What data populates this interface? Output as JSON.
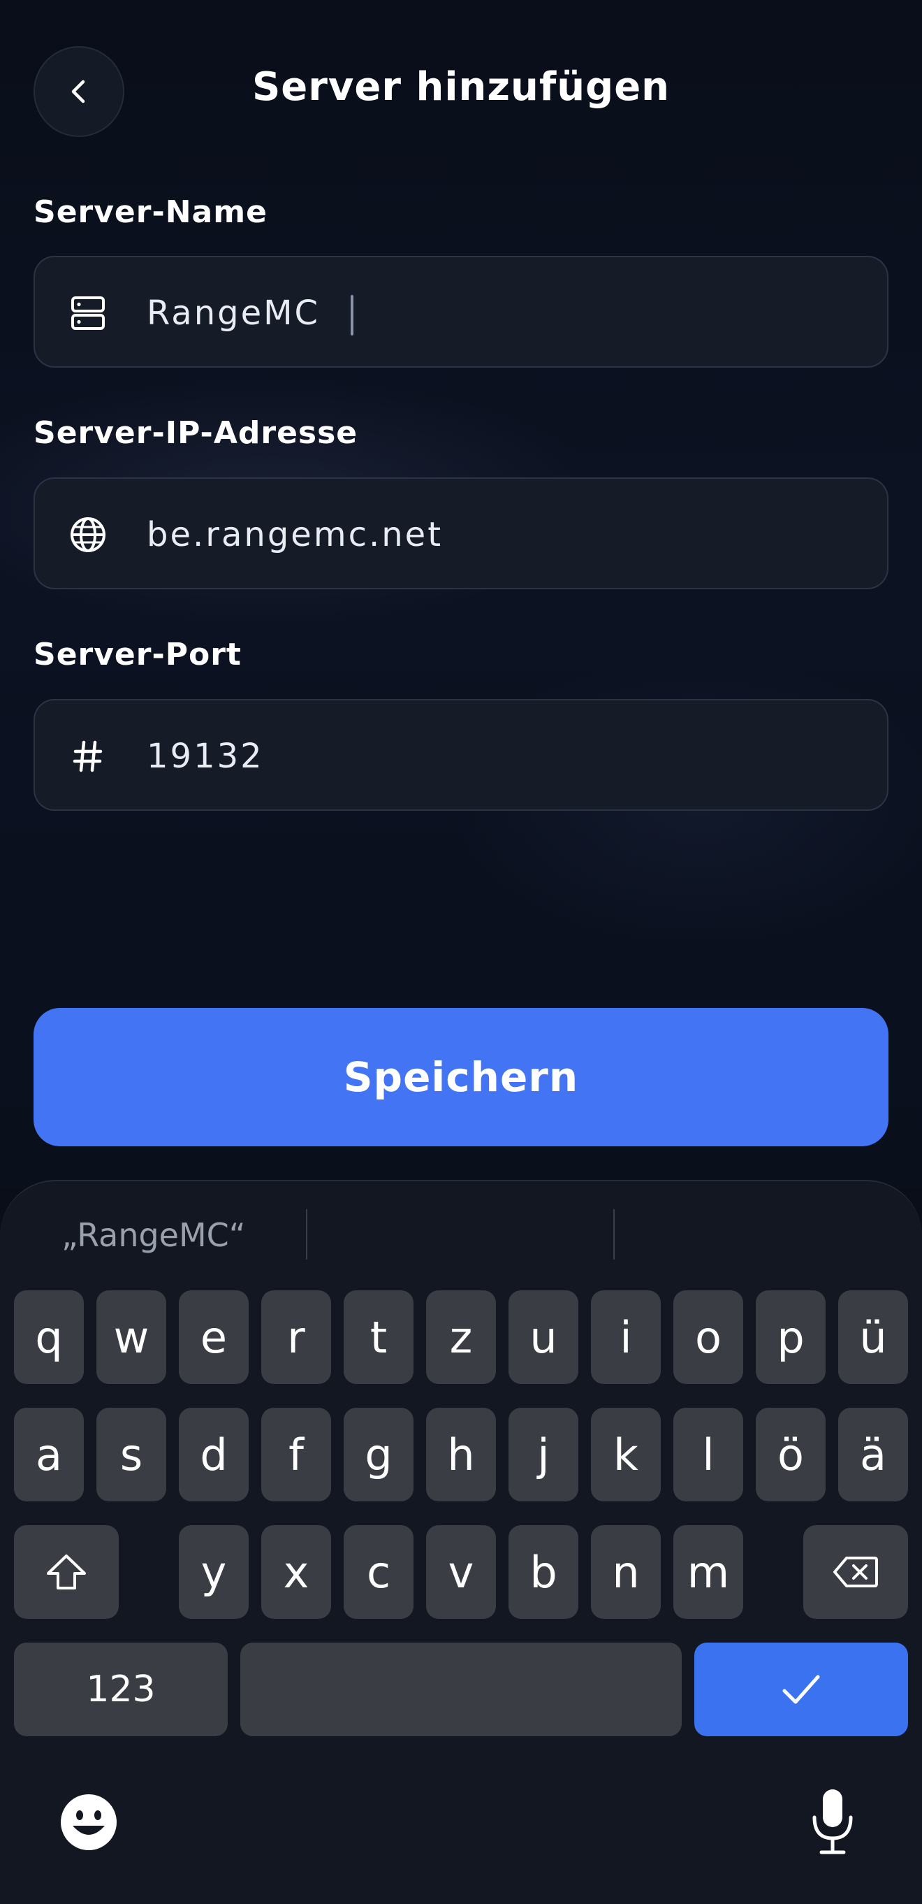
{
  "header": {
    "title": "Server hinzufügen",
    "back_icon": "chevron-left-icon"
  },
  "fields": [
    {
      "label": "Server-Name",
      "value": "RangeMC",
      "icon": "server-icon",
      "focused": true
    },
    {
      "label": "Server-IP-Adresse",
      "value": "be.rangemc.net",
      "icon": "globe-icon"
    },
    {
      "label": "Server-Port",
      "value": "19132",
      "icon": "hash-icon"
    }
  ],
  "save_label": "Speichern",
  "colors": {
    "accent": "#4274f4",
    "background": "#0a0e19",
    "field_bg": "#161b28",
    "key_bg": "#3a3d43"
  },
  "keyboard": {
    "suggestion": "„RangeMC“",
    "row1": [
      "q",
      "w",
      "e",
      "r",
      "t",
      "z",
      "u",
      "i",
      "o",
      "p",
      "ü"
    ],
    "row2": [
      "a",
      "s",
      "d",
      "f",
      "g",
      "h",
      "j",
      "k",
      "l",
      "ö",
      "ä"
    ],
    "row3": [
      "y",
      "x",
      "c",
      "v",
      "b",
      "n",
      "m"
    ],
    "numbers_label": "123",
    "shift_icon": "shift-icon",
    "backspace_icon": "backspace-icon",
    "done_icon": "checkmark-icon",
    "emoji_icon": "emoji-icon",
    "mic_icon": "microphone-icon"
  }
}
